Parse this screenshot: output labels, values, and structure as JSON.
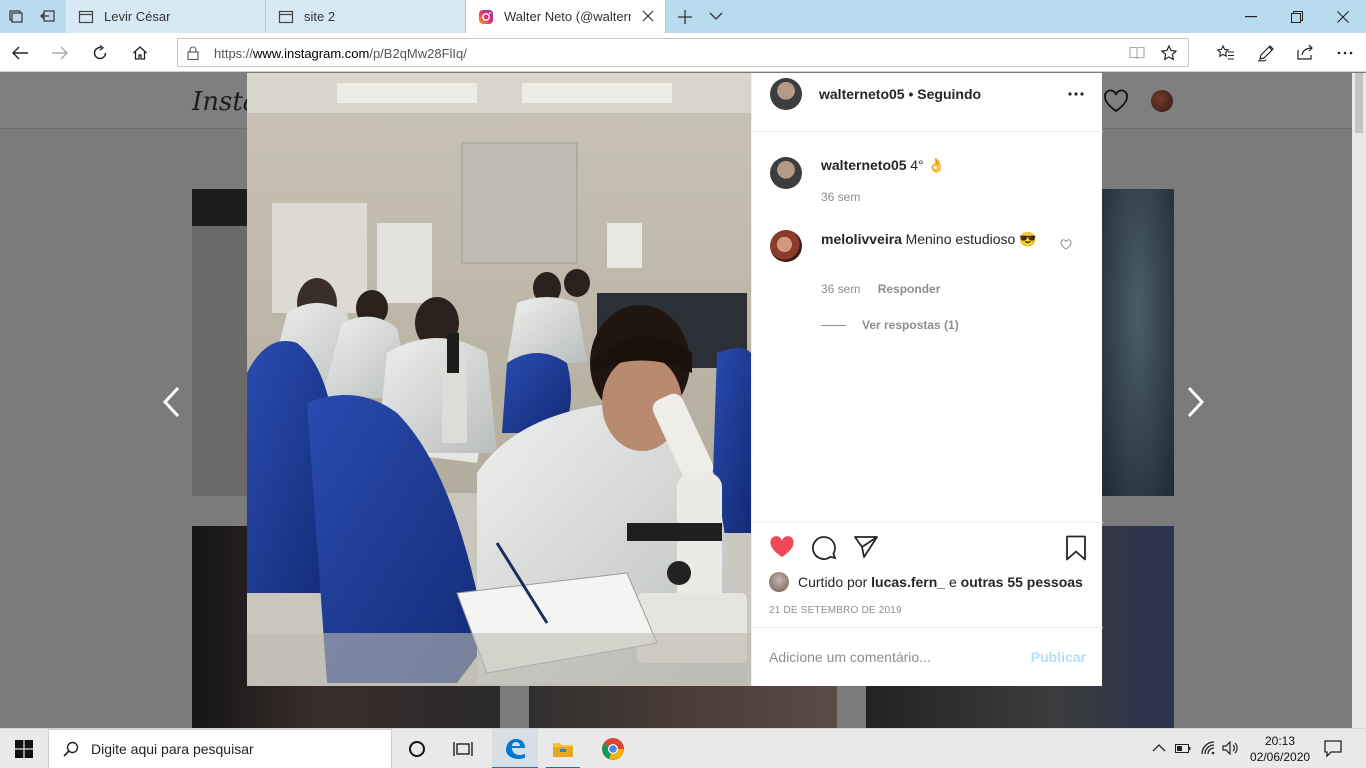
{
  "browser": {
    "tabs": [
      {
        "title": "Levir César",
        "active": false
      },
      {
        "title": "site 2",
        "active": false
      },
      {
        "title": "Walter Neto (@walterne",
        "active": true
      }
    ],
    "url_prefix": "https://",
    "url_domain": "www.instagram.com",
    "url_path": "/p/B2qMw28FlIq/"
  },
  "instagram": {
    "logo_text": "Insta",
    "post": {
      "username": "walterneto05",
      "follow_status": "• Seguindo",
      "caption_user": "walterneto05",
      "caption_text": "4° 👌",
      "caption_age": "36 sem",
      "comments": [
        {
          "user": "melolivveira",
          "text": "Menino estudioso 😎",
          "age": "36 sem",
          "reply_label": "Responder",
          "view_replies": "Ver respostas (1)"
        }
      ],
      "liked_prefix": "Curtido por",
      "liked_user": "lucas.fern_",
      "liked_middle": "e",
      "liked_others": "outras 55 pessoas",
      "date": "21 DE SETEMBRO DE 2019",
      "comment_placeholder": "Adicione um comentário...",
      "publish_label": "Publicar",
      "liked": true
    }
  },
  "taskbar": {
    "search_placeholder": "Digite aqui para pesquisar",
    "time": "20:13",
    "date": "02/06/2020"
  },
  "colors": {
    "like_red": "#ed4956",
    "edge_blue": "#0078d4",
    "publish_disabled": "#b2dffc"
  }
}
